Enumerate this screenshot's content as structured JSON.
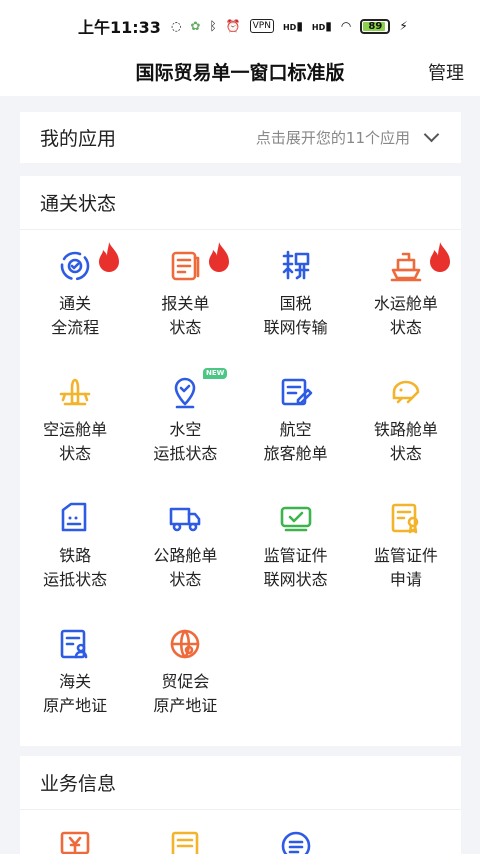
{
  "status_bar": {
    "time": "上午11:33",
    "vpn": "VPN",
    "hd1": "HD",
    "hd2": "HD",
    "battery": "89",
    "battery_level": 0.89
  },
  "header": {
    "title": "国际贸易单一窗口标准版",
    "manage": "管理"
  },
  "my_apps": {
    "label": "我的应用",
    "hint": "点击展开您的11个应用"
  },
  "customs_status": {
    "title": "通关状态",
    "tiles": [
      {
        "line1": "通关",
        "line2": "全流程",
        "icon": "customs-flow-icon",
        "color": "#2d5be3",
        "hot": true
      },
      {
        "line1": "报关单",
        "line2": "状态",
        "icon": "declaration-icon",
        "color": "#ef6a3a",
        "hot": true
      },
      {
        "line1": "国税",
        "line2": "联网传输",
        "icon": "tax-icon",
        "color": "#2d5be3",
        "hot": false
      },
      {
        "line1": "水运舱单",
        "line2": "状态",
        "icon": "ship-icon",
        "color": "#ef6a3a",
        "hot": true
      },
      {
        "line1": "空运舱单",
        "line2": "状态",
        "icon": "airplane-icon",
        "color": "#f3b32a",
        "hot": false
      },
      {
        "line1": "水空",
        "line2": "运抵状态",
        "icon": "location-icon",
        "color": "#2d5be3",
        "hot": false,
        "badge": "NEW"
      },
      {
        "line1": "航空",
        "line2": "旅客舱单",
        "icon": "passenger-icon",
        "color": "#2d5be3",
        "hot": false
      },
      {
        "line1": "铁路舱单",
        "line2": "状态",
        "icon": "train-icon",
        "color": "#f3b32a",
        "hot": false
      },
      {
        "line1": "铁路",
        "line2": "运抵状态",
        "icon": "rail-arrival-icon",
        "color": "#2d5be3",
        "hot": false
      },
      {
        "line1": "公路舱单",
        "line2": "状态",
        "icon": "truck-icon",
        "color": "#2d5be3",
        "hot": false
      },
      {
        "line1": "监管证件",
        "line2": "联网状态",
        "icon": "license-network-icon",
        "color": "#3cb44b",
        "hot": false
      },
      {
        "line1": "监管证件",
        "line2": "申请",
        "icon": "license-apply-icon",
        "color": "#f3b32a",
        "hot": false
      },
      {
        "line1": "海关",
        "line2": "原产地证",
        "icon": "origin-cert-icon",
        "color": "#2d5be3",
        "hot": false
      },
      {
        "line1": "贸促会",
        "line2": "原产地证",
        "icon": "globe-cert-icon",
        "color": "#ef6a3a",
        "hot": false
      }
    ]
  },
  "business_info": {
    "title": "业务信息",
    "icons": [
      {
        "icon": "yuan-icon",
        "color": "#ef6a3a"
      },
      {
        "icon": "document-icon",
        "color": "#f3b32a"
      },
      {
        "icon": "list-icon",
        "color": "#2d5be3"
      }
    ]
  }
}
